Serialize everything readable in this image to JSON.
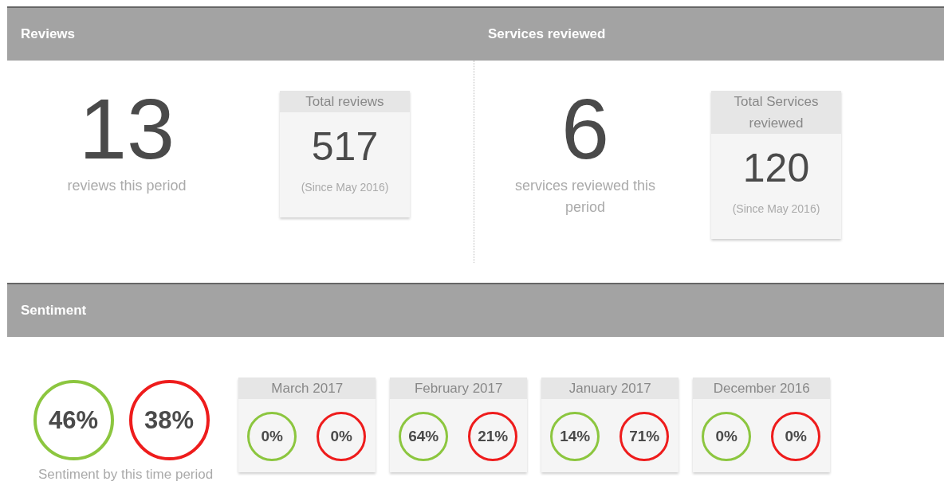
{
  "sections": [
    {
      "title": "Reviews",
      "big_number": "13",
      "caption": "reviews this period",
      "card": {
        "title": "Total reviews",
        "value": "517",
        "note": "(Since May 2016)"
      }
    },
    {
      "title": "Services reviewed",
      "big_number": "6",
      "caption": "services reviewed this period",
      "card": {
        "title": "Total Services reviewed",
        "value": "120",
        "note": "(Since May 2016)"
      }
    }
  ],
  "sentiment": {
    "title": "Sentiment",
    "overall": [
      {
        "kind": "positive",
        "value": "46%"
      },
      {
        "kind": "negative",
        "value": "38%"
      }
    ],
    "caption": "Sentiment by this time period",
    "months": [
      {
        "title": "March 2017",
        "scores": [
          {
            "kind": "positive",
            "value": "0%"
          },
          {
            "kind": "negative",
            "value": "0%"
          }
        ]
      },
      {
        "title": "February 2017",
        "scores": [
          {
            "kind": "positive",
            "value": "64%"
          },
          {
            "kind": "negative",
            "value": "21%"
          }
        ]
      },
      {
        "title": "January 2017",
        "scores": [
          {
            "kind": "positive",
            "value": "14%"
          },
          {
            "kind": "negative",
            "value": "71%"
          }
        ]
      },
      {
        "title": "December 2016",
        "scores": [
          {
            "kind": "positive",
            "value": "0%"
          },
          {
            "kind": "negative",
            "value": "0%"
          }
        ]
      }
    ]
  }
}
